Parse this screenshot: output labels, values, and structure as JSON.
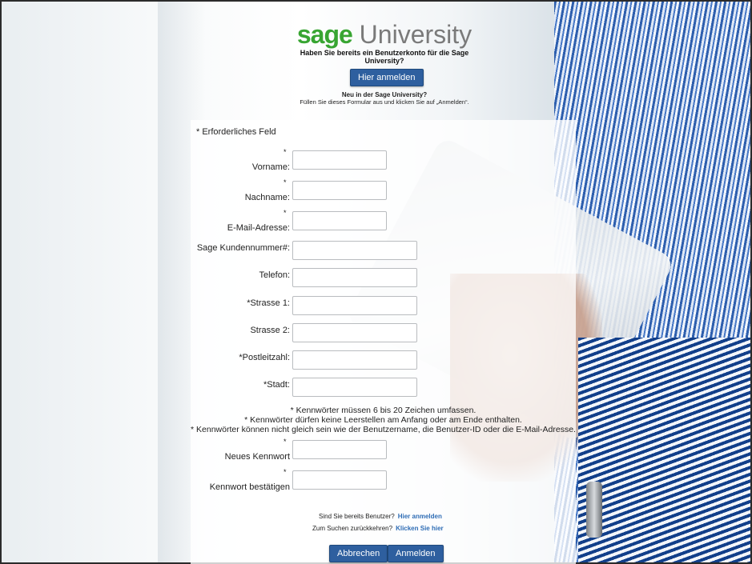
{
  "header": {
    "brand": "sage",
    "product": " University",
    "existing_account_question": "Haben Sie bereits ein Benutzerkonto für die Sage University?",
    "login_button": "Hier anmelden",
    "new_title": "Neu in der Sage University?",
    "new_subtitle": "Füllen Sie dieses Formular aus und klicken Sie auf „Anmelden“."
  },
  "form": {
    "required_note": "* Erforderliches Feld",
    "fields": {
      "vorname": {
        "label": "Vorname:",
        "star": "*",
        "value": ""
      },
      "nachname": {
        "label": "Nachname:",
        "star": "*",
        "value": ""
      },
      "email": {
        "label": "E-Mail-Adresse:",
        "star": "*",
        "value": ""
      },
      "kundennummer": {
        "label": "Sage Kundennummer#:",
        "value": ""
      },
      "telefon": {
        "label": "Telefon:",
        "value": ""
      },
      "strasse1": {
        "label": "*Strasse 1:",
        "value": ""
      },
      "strasse2": {
        "label": "Strasse 2:",
        "value": ""
      },
      "plz": {
        "label": "*Postleitzahl:",
        "value": ""
      },
      "stadt": {
        "label": "*Stadt:",
        "value": ""
      },
      "neues_kennwort": {
        "label": "Neues Kennwort",
        "star": "*",
        "value": ""
      },
      "kennwort_bestaetigen": {
        "label": "Kennwort bestätigen",
        "star": "*",
        "value": ""
      }
    },
    "password_rules": [
      "* Kennwörter müssen 6 bis 20 Zeichen umfassen.",
      "* Kennwörter dürfen keine Leerstellen am Anfang oder am Ende enthalten.",
      "* Kennwörter können nicht gleich sein wie der Benutzername, die Benutzer-ID oder die E-Mail-Adresse."
    ]
  },
  "footer": {
    "existing_user_text": "Sind Sie bereits Benutzer?",
    "existing_user_link": "Hier anmelden",
    "back_text": "Zum Suchen zurückkehren?",
    "back_link": "Klicken Sie hier",
    "cancel_button": "Abbrechen",
    "submit_button": "Anmelden"
  },
  "colors": {
    "brand_green": "#38a532",
    "button_blue": "#2e5f9f",
    "link_blue": "#2f6db5"
  }
}
